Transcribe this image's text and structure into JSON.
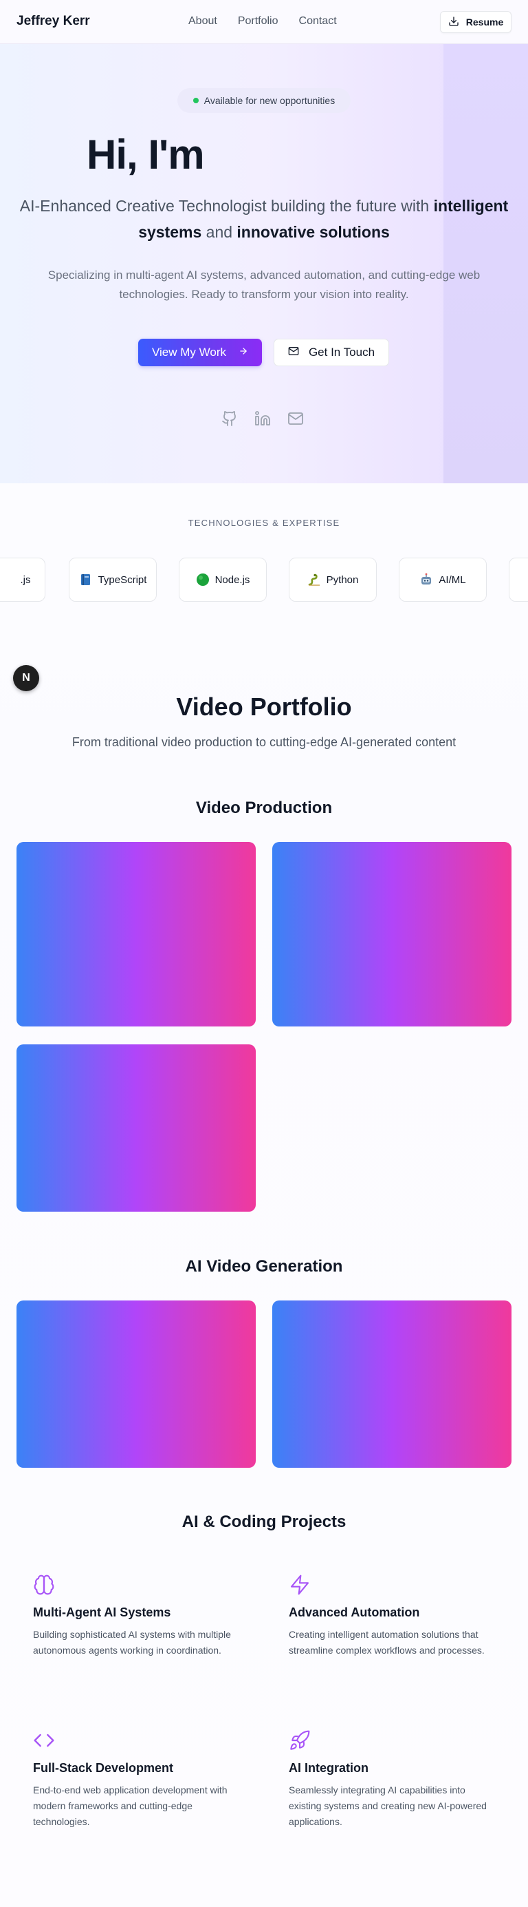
{
  "header": {
    "logo": "Jeffrey Kerr",
    "nav": [
      "About",
      "Portfolio",
      "Contact"
    ],
    "resume_label": "Resume"
  },
  "hero": {
    "badge": "Available for new opportunities",
    "title": "Hi, I'm",
    "subtitle_pre": "AI-Enhanced Creative Technologist building the future with ",
    "subtitle_bold1": "intelligent systems",
    "subtitle_mid": " and ",
    "subtitle_bold2": "innovative solutions",
    "description": "Specializing in multi-agent AI systems, advanced automation, and cutting-edge web technologies. Ready to transform your vision into reality.",
    "primary_button": "View My Work",
    "secondary_button": "Get In Touch",
    "socials": [
      "github-icon",
      "linkedin-icon",
      "mail-icon"
    ]
  },
  "tech": {
    "label": "TECHNOLOGIES & EXPERTISE",
    "items": [
      ".js",
      "TypeScript",
      "Node.js",
      "Python",
      "AI/ML"
    ]
  },
  "floating_button": "N",
  "portfolio": {
    "title": "Video Portfolio",
    "subtitle": "From traditional video production to cutting-edge AI-generated content",
    "video_production_title": "Video Production",
    "ai_video_title": "AI Video Generation"
  },
  "projects": {
    "title": "AI & Coding Projects",
    "items": [
      {
        "icon": "brain-icon",
        "title": "Multi-Agent AI Systems",
        "desc": "Building sophisticated AI systems with multiple autonomous agents working in coordination."
      },
      {
        "icon": "lightning-icon",
        "title": "Advanced Automation",
        "desc": "Creating intelligent automation solutions that streamline complex workflows and processes."
      },
      {
        "icon": "code-icon",
        "title": "Full-Stack Development",
        "desc": "End-to-end web application development with modern frameworks and cutting-edge technologies."
      },
      {
        "icon": "rocket-icon",
        "title": "AI Integration",
        "desc": "Seamlessly integrating AI capabilities into existing systems and creating new AI-powered applications."
      }
    ]
  },
  "colors": {
    "accent_purple": "#a855f7",
    "gradient_blue": "#3b82f6",
    "gradient_pink": "#f0399c",
    "status_green": "#22c55e"
  }
}
